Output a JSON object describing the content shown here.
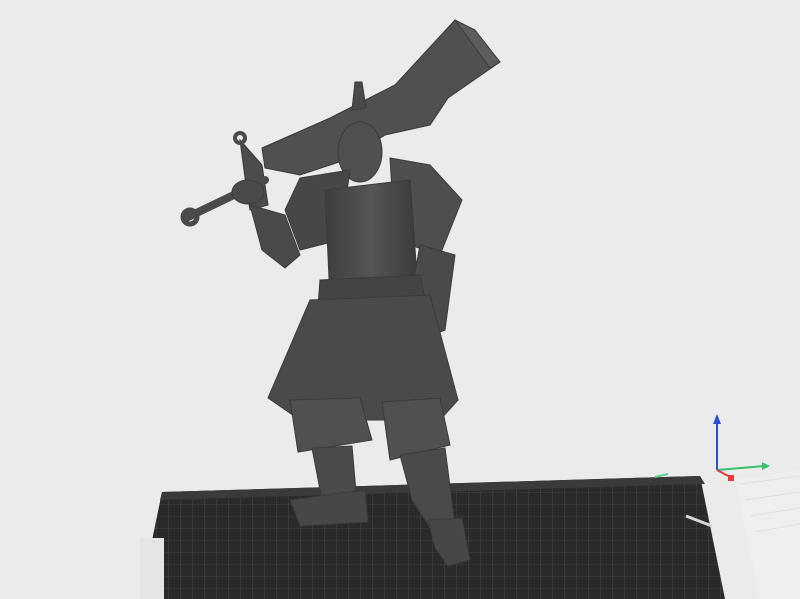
{
  "viewport": {
    "background": "#ebebeb",
    "model_color": "#4a4a4a",
    "plate_color": "#2a2a2a",
    "plate_grid_color": "#6a6a6a"
  },
  "build_plate": {
    "printed_text": "",
    "text_visible": false
  },
  "axis_gizmo": {
    "x_color": "#e23b3b",
    "y_color": "#35c26a",
    "z_color": "#2f4ed6"
  },
  "icons": {
    "model": "warrior-with-sword-model",
    "plate": "build-plate-grid",
    "gizmo": "xyz-axis-icon"
  }
}
